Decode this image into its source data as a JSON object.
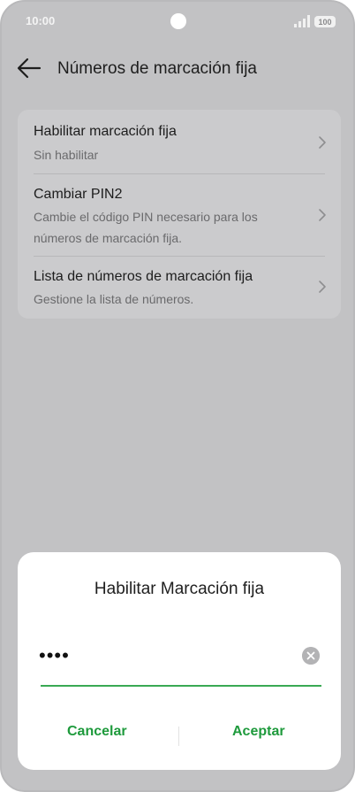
{
  "status_bar": {
    "time": "10:00",
    "battery": "100",
    "icons": [
      "camera-cutout",
      "signal-icon",
      "battery-icon"
    ]
  },
  "header": {
    "back_icon": "arrow-left-icon",
    "title": "Números de marcación fija"
  },
  "settings": {
    "items": [
      {
        "title": "Habilitar marcación fija",
        "subtitle": "Sin habilitar"
      },
      {
        "title": "Cambiar PIN2",
        "subtitle": "Cambie el código PIN necesario para los números de marcación fija."
      },
      {
        "title": "Lista de números de marcación fija",
        "subtitle": "Gestione la lista de números."
      }
    ]
  },
  "dialog": {
    "title": "Habilitar Marcación fija",
    "pin_value": "••••",
    "cancel_label": "Cancelar",
    "accept_label": "Aceptar"
  },
  "colors": {
    "accent": "#1e9a3c",
    "underline": "#3aa953",
    "backdrop": "#c2c2c4",
    "card": "#cbcbcd"
  }
}
